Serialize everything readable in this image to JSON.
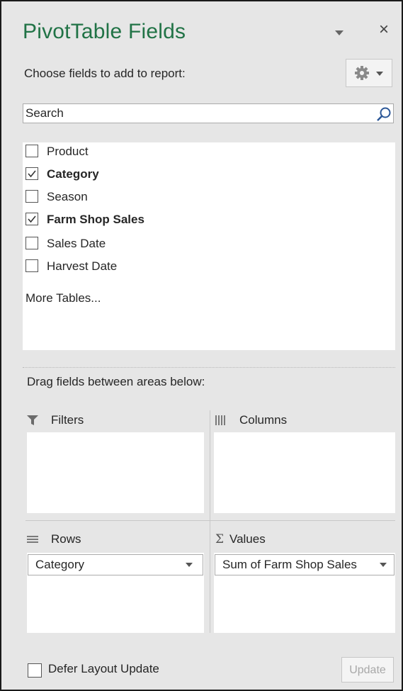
{
  "header": {
    "title": "PivotTable Fields",
    "choose_label": "Choose fields to add to report:",
    "close_symbol": "×",
    "icons": {
      "dropdown": "chevron-down-icon",
      "close": "close-icon",
      "tools": "gear-icon"
    }
  },
  "search": {
    "placeholder": "Search",
    "value": "",
    "icon": "search-icon"
  },
  "fields": [
    {
      "label": "Product",
      "checked": false
    },
    {
      "label": "Category",
      "checked": true
    },
    {
      "label": "Season",
      "checked": false
    },
    {
      "label": "Farm Shop Sales",
      "checked": true
    },
    {
      "label": "Sales Date",
      "checked": false
    },
    {
      "label": "Harvest Date",
      "checked": false
    }
  ],
  "more_tables": "More Tables...",
  "drag_label": "Drag fields between areas below:",
  "areas": {
    "filters": {
      "label": "Filters",
      "icon": "filter-icon",
      "items": []
    },
    "columns": {
      "label": "Columns",
      "icon": "columns-icon",
      "items": []
    },
    "rows": {
      "label": "Rows",
      "icon": "rows-icon",
      "items": [
        "Category"
      ]
    },
    "values": {
      "label": "Values",
      "icon": "sigma-icon",
      "symbol": "Σ",
      "items": [
        "Sum of Farm Shop Sales"
      ]
    }
  },
  "footer": {
    "defer_label": "Defer Layout Update",
    "defer_checked": false,
    "update_label": "Update",
    "update_enabled": false
  },
  "colors": {
    "title": "#217346",
    "panel_bg": "#e6e6e6",
    "box_bg": "#ffffff"
  }
}
